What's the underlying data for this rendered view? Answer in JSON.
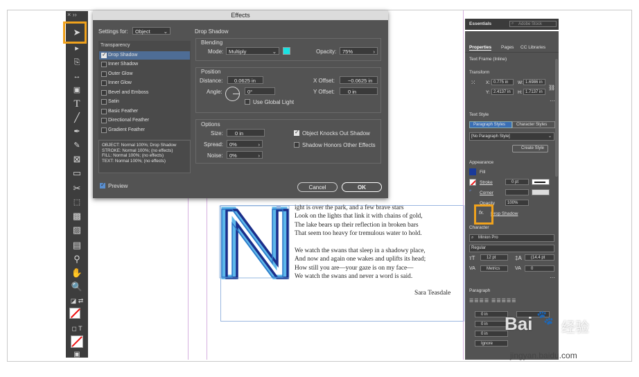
{
  "tools_panel": {
    "collapse_label": "× ››",
    "tools": [
      "selection-tool",
      "direct-selection-tool",
      "page-tool",
      "gap-tool",
      "content-collector-tool",
      "type-tool",
      "line-tool",
      "pen-tool",
      "pencil-tool",
      "rectangle-frame-tool",
      "rectangle-tool",
      "scissors-tool",
      "free-transform-tool",
      "gradient-swatch-tool",
      "gradient-feather-tool",
      "note-tool",
      "eyedropper-tool",
      "hand-tool",
      "zoom-tool"
    ]
  },
  "effects_dialog": {
    "title": "Effects",
    "settings_for_label": "Settings for:",
    "settings_for_value": "Object",
    "section_title": "Drop Shadow",
    "transparency_label": "Transparency",
    "effects_list": [
      {
        "label": "Drop Shadow",
        "checked": true,
        "selected": true
      },
      {
        "label": "Inner Shadow",
        "checked": false,
        "selected": false
      },
      {
        "label": "Outer Glow",
        "checked": false,
        "selected": false
      },
      {
        "label": "Inner Glow",
        "checked": false,
        "selected": false
      },
      {
        "label": "Bevel and Emboss",
        "checked": false,
        "selected": false
      },
      {
        "label": "Satin",
        "checked": false,
        "selected": false
      },
      {
        "label": "Basic Feather",
        "checked": false,
        "selected": false
      },
      {
        "label": "Directional Feather",
        "checked": false,
        "selected": false
      },
      {
        "label": "Gradient Feather",
        "checked": false,
        "selected": false
      }
    ],
    "summary": [
      "OBJECT: Normal 100%; Drop Shadow",
      "STROKE: Normal 100%; (no effects)",
      "FILL: Normal 100%; (no effects)",
      "TEXT: Normal 100%; (no effects)"
    ],
    "preview_label": "Preview",
    "blending": {
      "label": "Blending",
      "mode_label": "Mode:",
      "mode_value": "Multiply",
      "color": "#19e2e2",
      "opacity_label": "Opacity:",
      "opacity_value": "75%"
    },
    "position": {
      "label": "Position",
      "distance_label": "Distance:",
      "distance_value": "0.0625 in",
      "angle_label": "Angle:",
      "angle_value": "0°",
      "x_offset_label": "X Offset:",
      "x_offset_value": "−0.0625 in",
      "y_offset_label": "Y Offset:",
      "y_offset_value": "0 in",
      "global_light_label": "Use Global Light"
    },
    "options": {
      "label": "Options",
      "size_label": "Size:",
      "size_value": "0 in",
      "spread_label": "Spread:",
      "spread_value": "0%",
      "noise_label": "Noise:",
      "noise_value": "0%",
      "knocks_out_label": "Object Knocks Out Shadow",
      "honors_label": "Shadow Honors Other Effects"
    },
    "cancel_label": "Cancel",
    "ok_label": "OK"
  },
  "document": {
    "drop_cap": "N",
    "poem_lines": [
      "ight is over the park, and a few brave stars",
      "Look on the lights that link it with chains of gold,",
      "The lake bears up their reflection in broken bars",
      "That seem too heavy for tremulous water to hold.",
      "",
      "We watch the swans that sleep in a shadowy place,",
      "And now and again one wakes and uplifts its head;",
      "How still you are—your gaze is on my face—",
      "We watch the swans and never a word is said."
    ],
    "author": "Sara Teasdale"
  },
  "properties_panel": {
    "workspace_label": "Essentials",
    "search_placeholder": "Adobe Stock",
    "tabs": [
      "Properties",
      "Pages",
      "CC Libraries"
    ],
    "frame_type": "Text Frame (Inline)",
    "transform_label": "Transform",
    "x_label": "X:",
    "x_value": "0.775 in",
    "y_label": "Y:",
    "y_value": "2.4137 in",
    "w_label": "W:",
    "w_value": "1.6986 in",
    "h_label": "H:",
    "h_value": "1.7137 in",
    "text_style_label": "Text Style",
    "paragraph_styles_tab": "Paragraph Styles",
    "character_styles_tab": "Character Styles",
    "paragraph_style_value": "[No Paragraph Style]",
    "create_style_label": "Create Style",
    "appearance_label": "Appearance",
    "fill_label": "Fill",
    "stroke_label": "Stroke",
    "stroke_value": "0 pt",
    "corner_label": "Corner",
    "opacity_label": "Opacity",
    "opacity_value": "100%",
    "fx_label": "fx.",
    "drop_shadow_label": "Drop Shadow",
    "character_label": "Character",
    "font_family": "Minion Pro",
    "font_style": "Regular",
    "font_size": "12 pt",
    "leading": "(14.4 pt",
    "kerning": "Metrics",
    "tracking": "0",
    "paragraph_label": "Paragraph",
    "indent_left": "0 in",
    "indent_first": "0 in",
    "indent_value3": "0 in",
    "hyphenate_value": "Ignore",
    "accent_color": "#f0a21d",
    "fill_color": "#1a3a9a"
  },
  "watermark": {
    "brand": "Bai",
    "brand2": "经验",
    "url": "jingyan.baidu.com"
  }
}
